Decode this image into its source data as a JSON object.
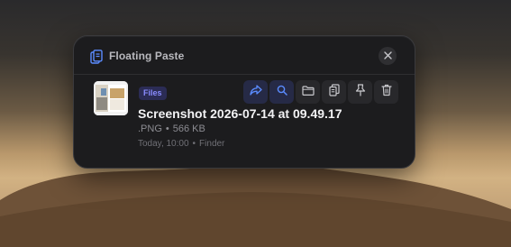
{
  "window": {
    "title": "Floating Paste"
  },
  "clip": {
    "badge": "Files",
    "filename": "Screenshot 2026-07-14 at 09.49.17",
    "type": ".PNG",
    "size": "566 KB",
    "separator": "•",
    "time": "Today, 10:00",
    "source": "Finder"
  },
  "actions": [
    {
      "icon": "share-icon"
    },
    {
      "icon": "search-icon"
    },
    {
      "icon": "folder-icon"
    },
    {
      "icon": "copy-icon"
    },
    {
      "icon": "pin-icon"
    },
    {
      "icon": "trash-icon"
    }
  ],
  "colors": {
    "accent": "#5b8cff",
    "badge_bg": "#2b2c55",
    "badge_text": "#8a8cff",
    "panel_bg": "#1c1c1e"
  }
}
